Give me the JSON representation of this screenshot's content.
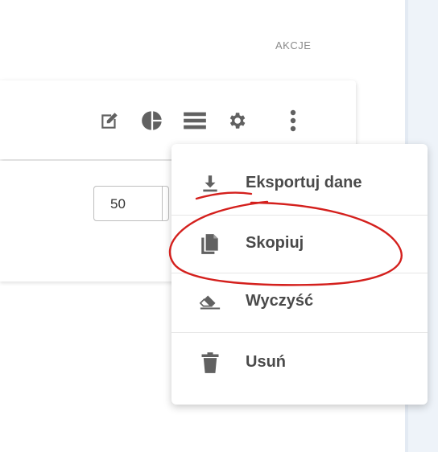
{
  "table": {
    "actions_header": "AKCJE"
  },
  "row_actions": {
    "icons": [
      "edit-icon",
      "pie-chart-icon",
      "list-icon",
      "gear-icon",
      "more-vert-icon"
    ]
  },
  "pager": {
    "page_size": "50"
  },
  "context_menu": {
    "items": [
      {
        "label": "Eksportuj dane",
        "icon": "download-icon"
      },
      {
        "label": "Skopiuj",
        "icon": "copy-icon"
      },
      {
        "label": "Wyczyść",
        "icon": "eraser-icon"
      },
      {
        "label": "Usuń",
        "icon": "trash-icon"
      }
    ]
  },
  "colors": {
    "icon_gray": "#616161",
    "annotation_red": "#d4201d",
    "side_panel": "#eef3f9"
  }
}
